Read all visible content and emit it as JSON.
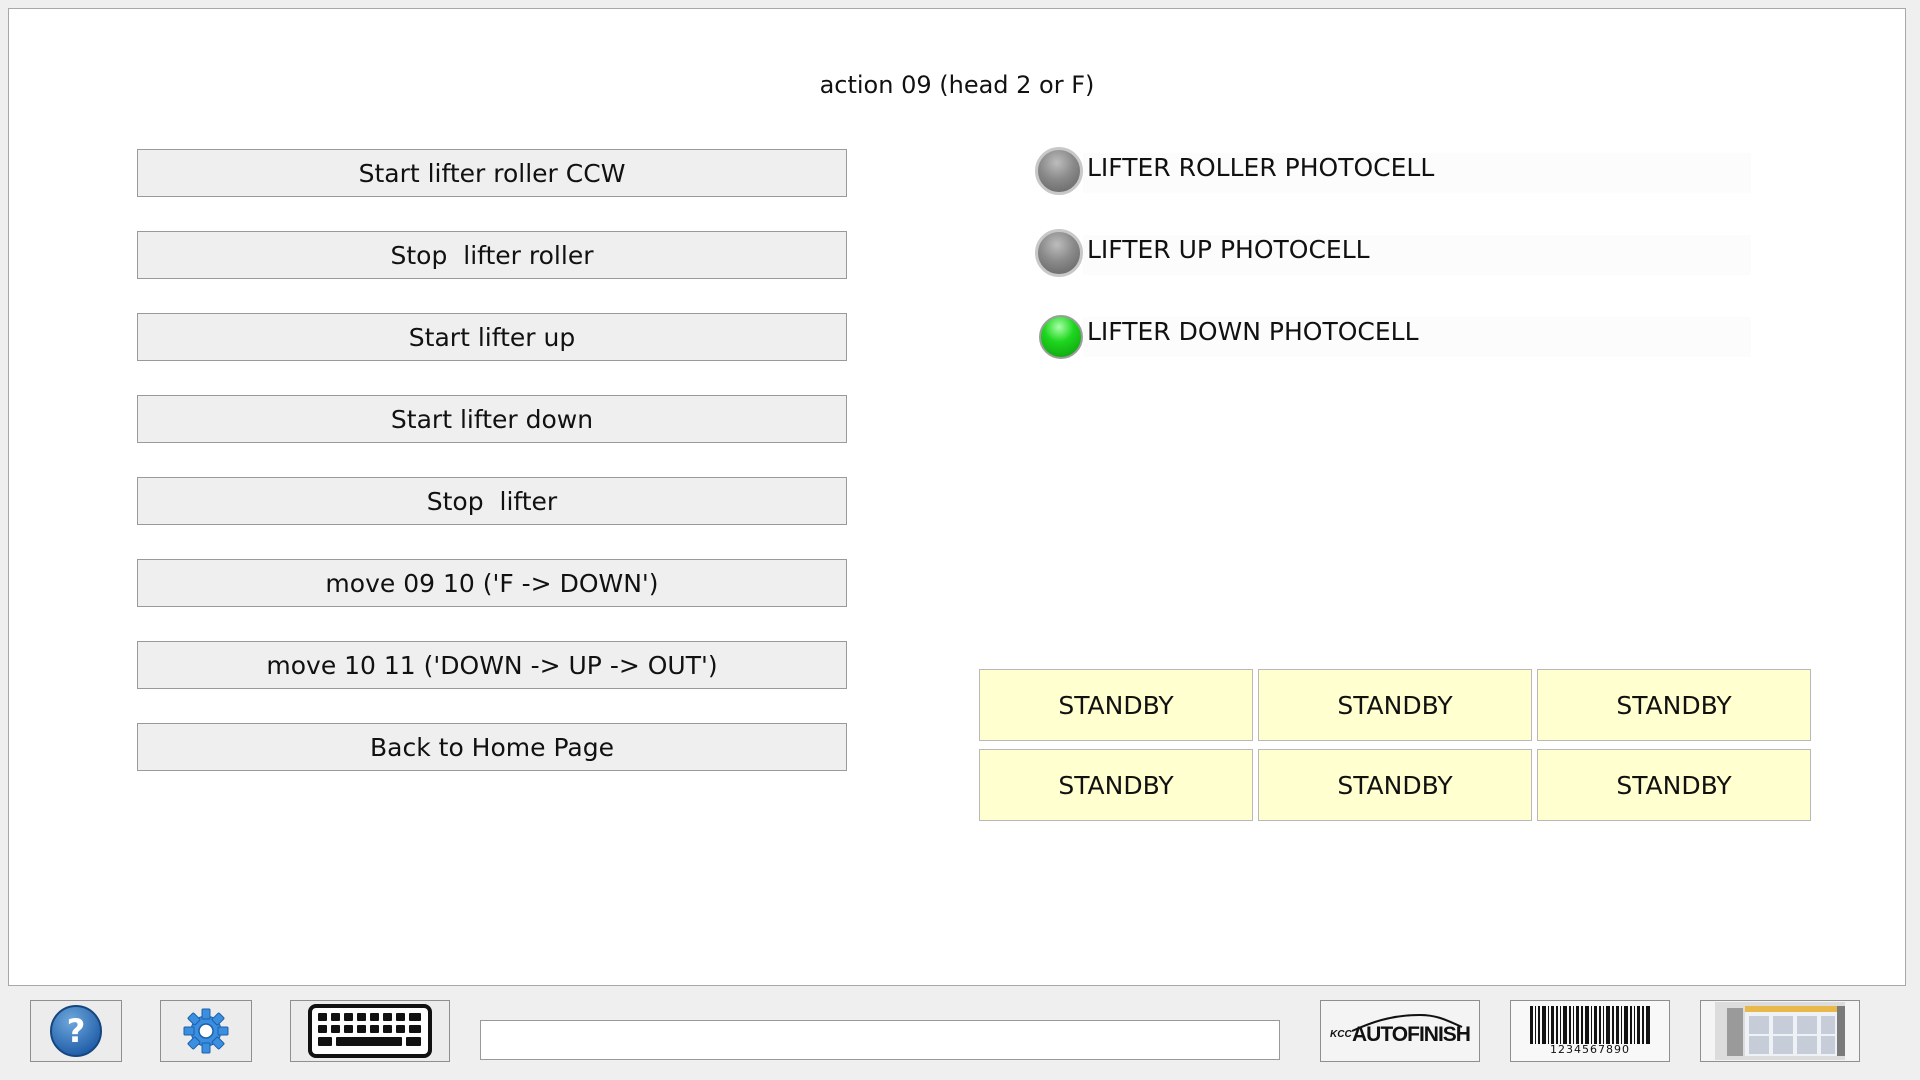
{
  "header": {
    "title": "action 09 (head 2 or F)"
  },
  "buttons": [
    {
      "label": "Start lifter roller CCW"
    },
    {
      "label": "Stop  lifter roller"
    },
    {
      "label": "Start lifter up"
    },
    {
      "label": "Start lifter down"
    },
    {
      "label": "Stop  lifter"
    },
    {
      "label": "move 09 10 ('F -> DOWN')"
    },
    {
      "label": "move 10 11 ('DOWN -> UP -> OUT')"
    },
    {
      "label": "Back to Home Page"
    }
  ],
  "photocells": [
    {
      "label": "LIFTER ROLLER PHOTOCELL",
      "state": "off",
      "color": "#8a8a8a"
    },
    {
      "label": "LIFTER UP PHOTOCELL",
      "state": "off",
      "color": "#8a8a8a"
    },
    {
      "label": "LIFTER DOWN PHOTOCELL",
      "state": "on",
      "color": "#1fd61f"
    }
  ],
  "status_grid": [
    {
      "label": "STANDBY"
    },
    {
      "label": "STANDBY"
    },
    {
      "label": "STANDBY"
    },
    {
      "label": "STANDBY"
    },
    {
      "label": "STANDBY"
    },
    {
      "label": "STANDBY"
    }
  ],
  "status_color": "#ffffcf",
  "toolbar": {
    "help_icon": "question-mark-icon",
    "settings_icon": "gear-icon",
    "keyboard_icon": "keyboard-icon",
    "input_value": "",
    "logo_brand": "KCC",
    "logo_text": "AUTOFINISH",
    "barcode_number": "1234567890",
    "machine_icon": "machine-thumbnail-icon"
  }
}
